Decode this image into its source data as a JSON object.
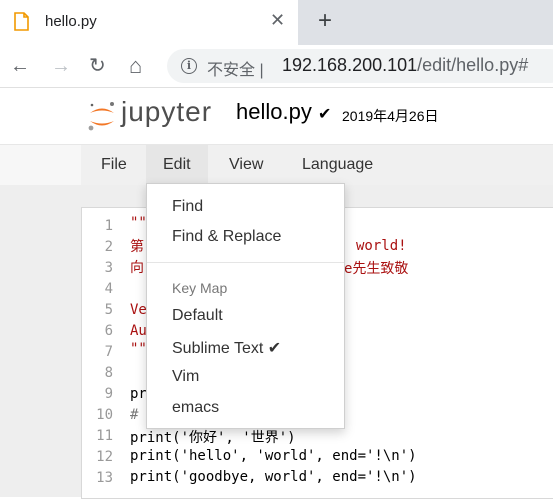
{
  "browser": {
    "tab_title": "hello.py",
    "close_glyph": "✕",
    "new_tab_glyph": "+",
    "back_glyph": "←",
    "forward_glyph": "→",
    "reload_glyph": "↻",
    "home_glyph": "⌂",
    "security_label": "不安全",
    "url_host": "192.168.200.101",
    "url_path": "/edit/hello.py#"
  },
  "header": {
    "logo_text": "jupyter",
    "file_name": "hello.py",
    "saved_glyph": "✔",
    "date": "2019年4月26日"
  },
  "menubar": {
    "items": [
      {
        "label": "File"
      },
      {
        "label": "Edit"
      },
      {
        "label": "View"
      },
      {
        "label": "Language"
      }
    ]
  },
  "edit_menu": {
    "find": "Find",
    "find_replace": "Find & Replace",
    "keymap_header": "Key Map",
    "default": "Default",
    "sublime": "Sublime Text",
    "sublime_check": "✔",
    "vim": "Vim",
    "emacs": "emacs"
  },
  "editor": {
    "line_numbers": [
      "1",
      "2",
      "3",
      "4",
      "5",
      "6",
      "7",
      "8",
      "9",
      "10",
      "11",
      "12",
      "13"
    ],
    "visible_fragments": {
      "l1": "\"\"",
      "l2a": "第",
      "l2b": "world!",
      "l3a": "向",
      "l3b": "e先生致敬",
      "l5": "Ve",
      "l6": "Au",
      "l7": "\"\"",
      "l9": "pr",
      "l10": "#"
    },
    "line11": "print('你好', '世界')",
    "line12": "print('hello', 'world', end='!\\n')",
    "line13": "print('goodbye, world', end='!\\n')"
  },
  "colors": {
    "string": "#aa1111",
    "accent": "#f37726"
  }
}
